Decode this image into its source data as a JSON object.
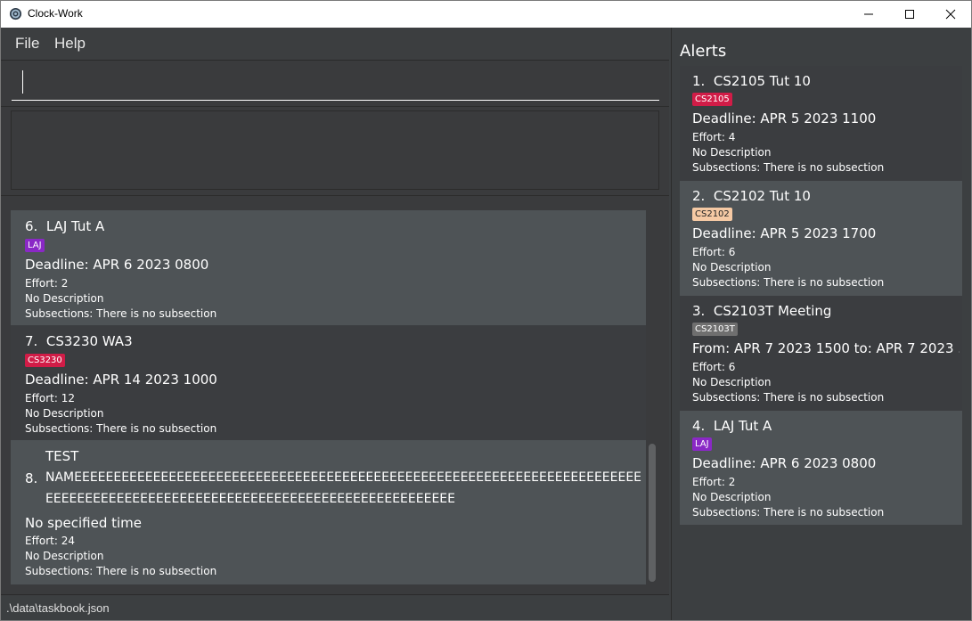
{
  "window": {
    "title": "Clock-Work"
  },
  "menu": {
    "file": "File",
    "help": "Help"
  },
  "command": {
    "value": "",
    "placeholder": ""
  },
  "result": {
    "text": ""
  },
  "status": {
    "path": ".\\data\\taskbook.json"
  },
  "tasks": [
    {
      "index": "6.",
      "name": "LAJ Tut A",
      "tag": "LAJ",
      "tag_color": "#8a28c6",
      "time": "Deadline: APR 6 2023 0800",
      "effort": "Effort: 2",
      "description": "No Description",
      "subsections": "Subsections: There is no subsection"
    },
    {
      "index": "7.",
      "name": "CS3230 WA3",
      "tag": "CS3230",
      "tag_color": "#d11c47",
      "time": "Deadline: APR 14 2023 1000",
      "effort": "Effort: 12",
      "description": "No Description",
      "subsections": "Subsections: There is no subsection"
    },
    {
      "index": "8.",
      "name_line1": "TEST",
      "name_line2": "NAMEEEEEEEEEEEEEEEEEEEEEEEEEEEEEEEEEEEEEEEEEEEEEEEEEEEEEEEEEEEEEEEEEEEEEEEEEEEEEE",
      "name_line3": "EEEEEEEEEEEEEEEEEEEEEEEEEEEEEEEEEEEEEEEEEEEEEEEEEEEE",
      "time": "No specified time",
      "effort": "Effort: 24",
      "description": "No Description",
      "subsections": "Subsections: There is no subsection"
    }
  ],
  "alerts": {
    "title": "Alerts",
    "items": [
      {
        "index": "1.",
        "name": "CS2105 Tut 10",
        "tag": "CS2105",
        "tag_color": "#d11c47",
        "time": "Deadline: APR 5 2023 1100",
        "effort": "Effort: 4",
        "description": "No Description",
        "subsections": "Subsections: There is no subsection"
      },
      {
        "index": "2.",
        "name": "CS2102 Tut 10",
        "tag": "CS2102",
        "tag_color": "#f5c9a4",
        "time": "Deadline: APR 5 2023 1700",
        "effort": "Effort: 6",
        "description": "No Description",
        "subsections": "Subsections: There is no subsection"
      },
      {
        "index": "3.",
        "name": "CS2103T Meeting",
        "tag": "CS2103T",
        "tag_color": "#6f6f6f",
        "time": "From: APR 7 2023 1500 to: APR 7 2023 ...",
        "effort": "Effort: 6",
        "description": "No Description",
        "subsections": "Subsections: There is no subsection"
      },
      {
        "index": "4.",
        "name": "LAJ Tut A",
        "tag": "LAJ",
        "tag_color": "#8a28c6",
        "time": "Deadline: APR 6 2023 0800",
        "effort": "Effort: 2",
        "description": "No Description",
        "subsections": "Subsections: There is no subsection"
      }
    ]
  },
  "icons": {
    "app": "gear-icon",
    "minimize": "minimize-icon",
    "maximize": "maximize-icon",
    "close": "close-icon"
  }
}
